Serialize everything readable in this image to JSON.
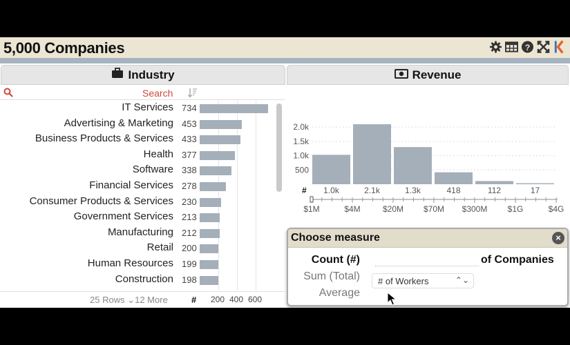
{
  "header": {
    "title": "5,000 Companies"
  },
  "industry": {
    "title": "Industry",
    "search_label": "Search",
    "rows": [
      {
        "name": "IT Services",
        "count": 734
      },
      {
        "name": "Advertising & Marketing",
        "count": 453
      },
      {
        "name": "Business Products & Services",
        "count": 433
      },
      {
        "name": "Health",
        "count": 377
      },
      {
        "name": "Software",
        "count": 338
      },
      {
        "name": "Financial Services",
        "count": 278
      },
      {
        "name": "Consumer Products & Services",
        "count": 230
      },
      {
        "name": "Government Services",
        "count": 213
      },
      {
        "name": "Manufacturing",
        "count": 212
      },
      {
        "name": "Retail",
        "count": 200
      },
      {
        "name": "Human Resources",
        "count": 199
      },
      {
        "name": "Construction",
        "count": 198
      }
    ],
    "footer_rows": "25 Rows",
    "footer_more": "12 More",
    "footer_hash": "#",
    "axis_ticks": [
      "200",
      "400",
      "600"
    ]
  },
  "revenue": {
    "title": "Revenue",
    "chart_data": {
      "type": "bar",
      "categories": [
        "$1M-$4M",
        "$4M-$20M",
        "$20M-$70M",
        "$70M-$300M",
        "$300M-$1G",
        "$1G-$4G"
      ],
      "values": [
        1030,
        2100,
        1300,
        418,
        112,
        17
      ],
      "data_labels": [
        "1.0k",
        "2.1k",
        "1.3k",
        "418",
        "112",
        "17"
      ],
      "y_ticks": [
        "500",
        "1.0k",
        "1.5k",
        "2.0k"
      ],
      "x_ticks": [
        "$1M",
        "$4M",
        "$20M",
        "$70M",
        "$300M",
        "$1G",
        "$4G"
      ],
      "count_label": "#",
      "ylim": [
        0,
        2250
      ]
    }
  },
  "measure_dialog": {
    "title": "Choose measure",
    "close": "×",
    "options": [
      "Count (#)",
      "Sum (Total)",
      "Average"
    ],
    "suffix": "of Companies",
    "field_select": "# of Workers"
  },
  "colors": {
    "bar": "#a5afba",
    "accent": "#d0463c",
    "header_bg": "#ece5d3",
    "blue_strip": "#a6b3c0"
  }
}
